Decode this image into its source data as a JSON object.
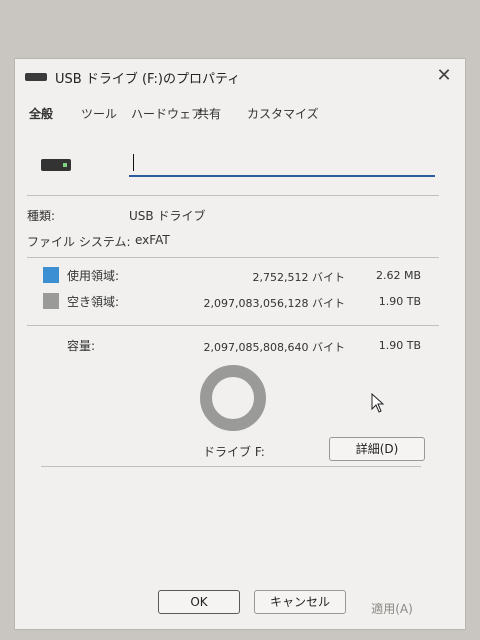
{
  "window": {
    "title": "USB ドライブ (F:)のプロパティ",
    "close_glyph": "✕"
  },
  "tabs": [
    {
      "label": "全般",
      "active": true
    },
    {
      "label": "ツール",
      "active": false
    },
    {
      "label": "ハードウェア",
      "active": false
    },
    {
      "label": "共有",
      "active": false
    },
    {
      "label": "カスタマイズ",
      "active": false
    }
  ],
  "drive_name": {
    "value": ""
  },
  "info": {
    "type_label": "種類:",
    "type_value": "USB ドライブ",
    "fs_label": "ファイル システム:",
    "fs_value": "exFAT"
  },
  "space": {
    "used": {
      "label": "使用領域:",
      "bytes": "2,752,512 バイト",
      "size": "2.62 MB",
      "color": "#3b8fd2"
    },
    "free": {
      "label": "空き領域:",
      "bytes": "2,097,083,056,128 バイト",
      "size": "1.90 TB",
      "color": "#9a9a98"
    },
    "capacity": {
      "label": "容量:",
      "bytes": "2,097,085,808,640 バイト",
      "size": "1.90 TB"
    },
    "used_fraction": 1.3e-06
  },
  "drive_label": "ドライブ F:",
  "detail_button": "詳細(D)",
  "footer": {
    "ok": "OK",
    "cancel": "キャンセル",
    "apply": "適用(A)"
  }
}
